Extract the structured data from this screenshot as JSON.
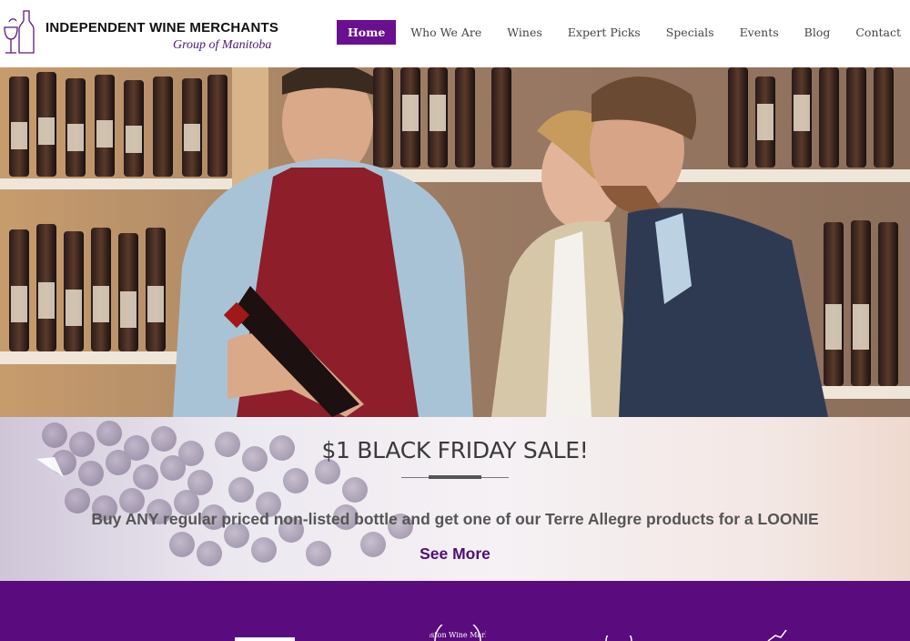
{
  "header": {
    "logo_title": "INDEPENDENT WINE MERCHANTS",
    "logo_subtitle": "Group of Manitoba",
    "nav": [
      {
        "label": "Home",
        "active": true
      },
      {
        "label": "Who We Are"
      },
      {
        "label": "Wines"
      },
      {
        "label": "Expert Picks"
      },
      {
        "label": "Specials"
      },
      {
        "label": "Events"
      },
      {
        "label": "Blog"
      },
      {
        "label": "Contact"
      }
    ]
  },
  "promo": {
    "title": "$1 BLACK FRIDAY SALE!",
    "text": "Buy ANY regular priced non-listed bottle and get one of our Terre Allegre products for a LOONIE",
    "link": "See More"
  },
  "partners": {
    "stamp_text": "nston Wine Mark"
  },
  "colors": {
    "brand_purple": "#6a0f8f",
    "footer_purple": "#5a0c7e",
    "link_purple": "#4d0f73"
  }
}
